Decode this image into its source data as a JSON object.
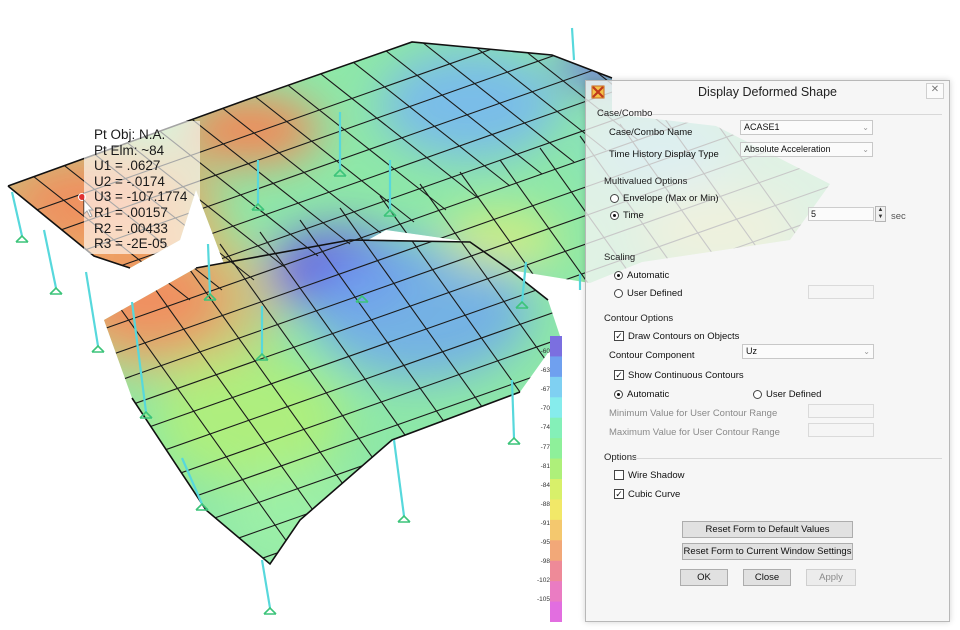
{
  "point_info": {
    "lines": [
      "Pt Obj: N.A.",
      "Pt Elm: ~84",
      "U1 = .0627",
      "U2 = -.0174",
      "U3 = -107.1774",
      "R1 = .00157",
      "R2 = .00433",
      "R3 = -2E-05"
    ]
  },
  "legend": {
    "labels": [
      "-60",
      "-63",
      "-67",
      "-70",
      "-74",
      "-77",
      "-81",
      "-84",
      "-88",
      "-91",
      "-95",
      "-98",
      "-102",
      "-105"
    ],
    "colors": [
      "#7b6fe0",
      "#6fa0ef",
      "#7fd0f2",
      "#86ecec",
      "#84f0b8",
      "#8ef09a",
      "#aef07a",
      "#d8f06a",
      "#f2e868",
      "#f4c86e",
      "#f2a878",
      "#ee8a98",
      "#ea7cc2",
      "#e26ee0"
    ]
  },
  "dialog": {
    "title": "Display Deformed Shape",
    "close_glyph": "✕",
    "case_combo": {
      "section": "Case/Combo",
      "name_label": "Case/Combo Name",
      "name_value": "ACASE1",
      "th_label": "Time History Display Type",
      "th_value": "Absolute Acceleration"
    },
    "multivalued": {
      "section": "Multivalued Options",
      "envelope_label": "Envelope (Max or Min)",
      "time_label": "Time",
      "time_value": "5",
      "time_unit": "sec"
    },
    "scaling": {
      "section": "Scaling",
      "automatic_label": "Automatic",
      "user_defined_label": "User Defined"
    },
    "contour": {
      "section": "Contour Options",
      "draw_label": "Draw Contours on Objects",
      "component_label": "Contour Component",
      "component_value": "Uz",
      "continuous_label": "Show Continuous Contours",
      "automatic_label": "Automatic",
      "user_defined_label": "User Defined",
      "min_label": "Minimum Value for User Contour Range",
      "max_label": "Maximum Value for User Contour Range"
    },
    "options": {
      "section": "Options",
      "wire_shadow_label": "Wire Shadow",
      "cubic_curve_label": "Cubic Curve"
    },
    "buttons": {
      "reset_default": "Reset Form to Default Values",
      "reset_current": "Reset Form to Current Window Settings",
      "ok": "OK",
      "close": "Close",
      "apply": "Apply"
    }
  },
  "colors": {
    "mesh_line": "#1a1a1a",
    "column": "#57d8dc",
    "support": "#3cc47a",
    "hot": "#ee5e5e",
    "cold": "#6a62e0"
  }
}
